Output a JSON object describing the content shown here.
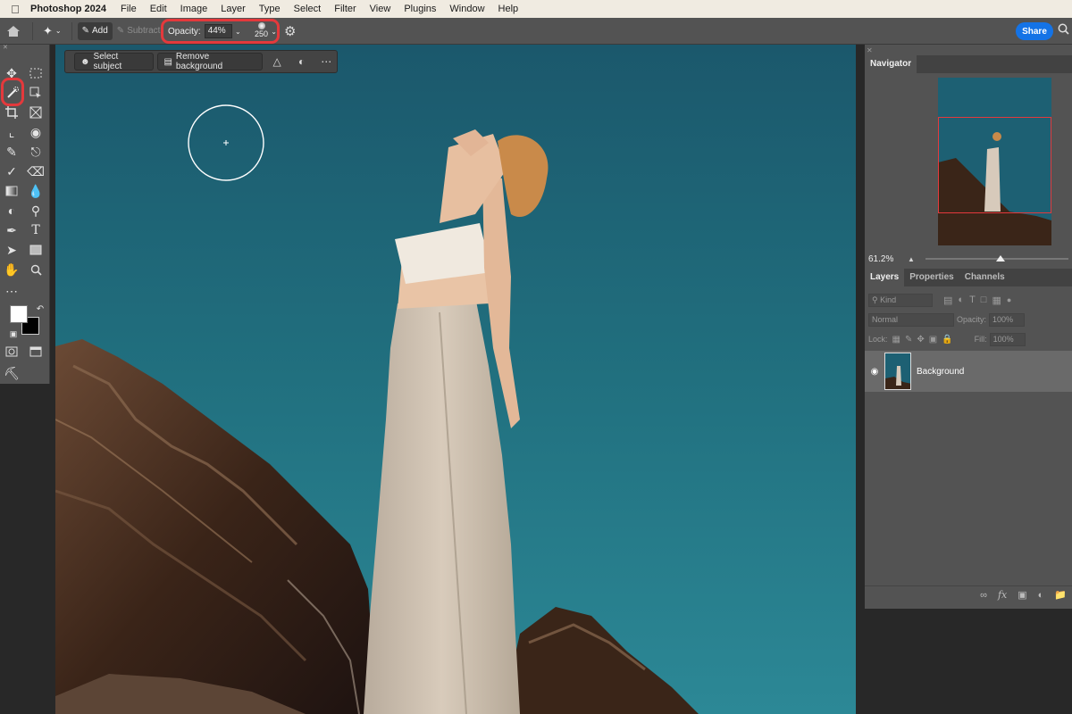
{
  "menubar": {
    "app_name": "Photoshop 2024",
    "items": [
      "File",
      "Edit",
      "Image",
      "Layer",
      "Type",
      "Select",
      "Filter",
      "View",
      "Plugins",
      "Window",
      "Help"
    ]
  },
  "options_bar": {
    "add_label": "Add",
    "subtract_label": "Subtract",
    "opacity_label": "Opacity:",
    "opacity_value": "44%",
    "brush_size": "250",
    "share_label": "Share"
  },
  "context_bar": {
    "select_subject_label": "Select subject",
    "remove_background_label": "Remove background"
  },
  "colors": {
    "foreground": "#ffffff",
    "background": "#000000",
    "highlight": "#e4393c",
    "accent": "#1473e6"
  },
  "navigator": {
    "tab_label": "Navigator",
    "zoom": "61.2%"
  },
  "layers_panel": {
    "tabs": [
      "Layers",
      "Properties",
      "Channels"
    ],
    "kind_placeholder": "Kind",
    "blend_mode": "Normal",
    "opacity_label": "Opacity:",
    "opacity_value": "100%",
    "lock_label": "Lock:",
    "fill_label": "Fill:",
    "fill_value": "100%",
    "layers": [
      {
        "name": "Background",
        "visible": true
      }
    ]
  }
}
